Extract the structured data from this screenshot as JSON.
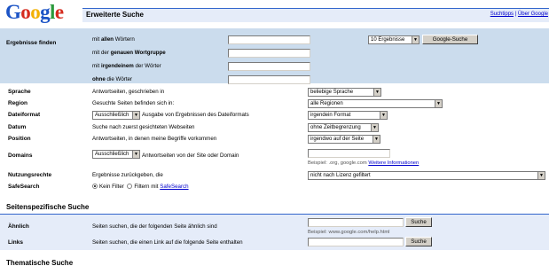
{
  "logo": {
    "letters": [
      "G",
      "o",
      "o",
      "g",
      "l",
      "e"
    ],
    "colors": [
      "#1c54c6",
      "#d52b1e",
      "#f3b000",
      "#1c54c6",
      "#2a9a3c",
      "#d52b1e"
    ]
  },
  "header": {
    "title": "Erweiterte Suche",
    "link_tips": "Suchtipps",
    "separator": "|",
    "link_about": "Über Google"
  },
  "find": {
    "label": "Ergebnisse finden",
    "rows": [
      {
        "prefix": "mit ",
        "bold": "allen",
        "suffix": " Wörtern",
        "value": ""
      },
      {
        "prefix": "mit der ",
        "bold": "genauen Wortgruppe",
        "suffix": "",
        "value": ""
      },
      {
        "prefix": "mit ",
        "bold": "irgendeinem",
        "suffix": " der Wörter",
        "value": ""
      },
      {
        "prefix": "",
        "bold": "ohne",
        "suffix": " die Wörter",
        "value": ""
      }
    ],
    "results_select": "10 Ergebnisse",
    "search_button": "Google-Suche"
  },
  "options": [
    {
      "key": "sprache",
      "label": "Sprache",
      "desc": "Antwortseiten, geschrieben in",
      "value": "beliebige Sprache"
    },
    {
      "key": "region",
      "label": "Region",
      "desc": "Gesuchte Seiten befinden sich in:",
      "value": "alle Regionen"
    },
    {
      "key": "dateiformat",
      "label": "Dateiformat",
      "pre_select": "Ausschließlich",
      "desc": "Ausgabe von Ergebnissen des Dateiformats",
      "value": "irgendein Format"
    },
    {
      "key": "datum",
      "label": "Datum",
      "desc": "Suche nach zuerst gesichteten Webseiten",
      "value": "ohne Zeitbegrenzung"
    },
    {
      "key": "position",
      "label": "Position",
      "desc": "Antwortseiten, in denen meine Begriffe vorkommen",
      "value": "irgendwo auf der Seite"
    },
    {
      "key": "domains",
      "label": "Domains",
      "pre_select": "Ausschließlich",
      "desc": "Antwortseiten von der Site oder Domain",
      "value": ""
    },
    {
      "key": "nutzungsrechte",
      "label": "Nutzungsrechte",
      "desc": "Ergebnisse zurückgeben, die",
      "value": "nicht nach Lizenz gefiltert"
    }
  ],
  "domains_hint": {
    "text": "Beispiel: .org, google.com",
    "link": "Weitere Informationen"
  },
  "safesearch": {
    "label": "SafeSearch",
    "opt1": "Kein Filter",
    "opt2_prefix": "Filtern mit",
    "opt2_link": "SafeSearch",
    "selected": "opt1"
  },
  "page_specific": {
    "title": "Seitenspezifische Suche",
    "similar": {
      "label": "Ähnlich",
      "desc": "Seiten suchen, die der folgenden Seite ähnlich sind",
      "value": "",
      "button": "Suche",
      "hint": "Beispiel: www.google.com/help.html"
    },
    "links": {
      "label": "Links",
      "desc": "Seiten suchen, die einen Link auf die folgende Seite enthalten",
      "value": "",
      "button": "Suche"
    }
  },
  "topical": {
    "title": "Thematische Suche"
  }
}
